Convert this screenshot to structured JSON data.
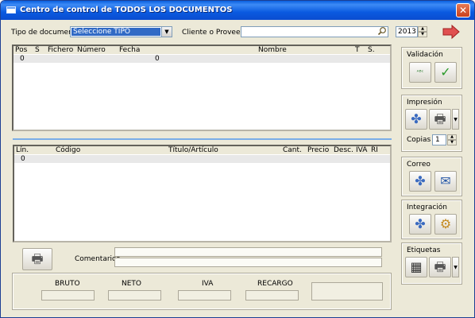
{
  "window": {
    "title": "Centro de control de TODOS LOS DOCUMENTOS",
    "close": "✕"
  },
  "filters": {
    "tipo_label": "Tipo de documento",
    "tipo_value": "Seleccione TIPO",
    "cliente_label": "Cliente o Proveedor",
    "cliente_value": "",
    "year_value": "2013"
  },
  "top_grid": {
    "columns": [
      "Pos",
      "S",
      "Fichero",
      "Número",
      "Fecha",
      "Nombre",
      "T",
      "S."
    ],
    "row": {
      "pos": "0",
      "fecha": "0"
    }
  },
  "bottom_grid": {
    "columns": [
      "Lín.",
      "Código",
      "Título/Artículo",
      "Cant.",
      "Precio",
      "Desc.",
      "IVA",
      "RI"
    ],
    "row": {
      "lin": "0"
    }
  },
  "panels": {
    "validacion": {
      "title": "Validación"
    },
    "impresion": {
      "title": "Impresión",
      "copias_label": "Copias",
      "copias_value": "1"
    },
    "correo": {
      "title": "Correo"
    },
    "integracion": {
      "title": "Integración"
    },
    "etiquetas": {
      "title": "Etiquetas"
    }
  },
  "comentarios": {
    "label": "Comentarios",
    "line1": "",
    "line2": ""
  },
  "totals": {
    "bruto": {
      "label": "BRUTO",
      "value": ""
    },
    "neto": {
      "label": "NETO",
      "value": ""
    },
    "iva": {
      "label": "IVA",
      "value": ""
    },
    "recargo": {
      "label": "RECARGO",
      "value": ""
    },
    "total": {
      "value": ""
    }
  },
  "icons": {
    "search": "🔍",
    "exit": "➔",
    "spell": "ᴬᴮᶜ",
    "check": "✓",
    "fan": "✤",
    "printer": "🖶",
    "chevron": "▾",
    "mail": "✉",
    "integrate": "⚙",
    "labels": "▦"
  },
  "colors": {
    "selection": "#316ac5",
    "title_bar": "#0a5ae0",
    "separator": "#7aaee8",
    "exit_red": "#e05050"
  }
}
